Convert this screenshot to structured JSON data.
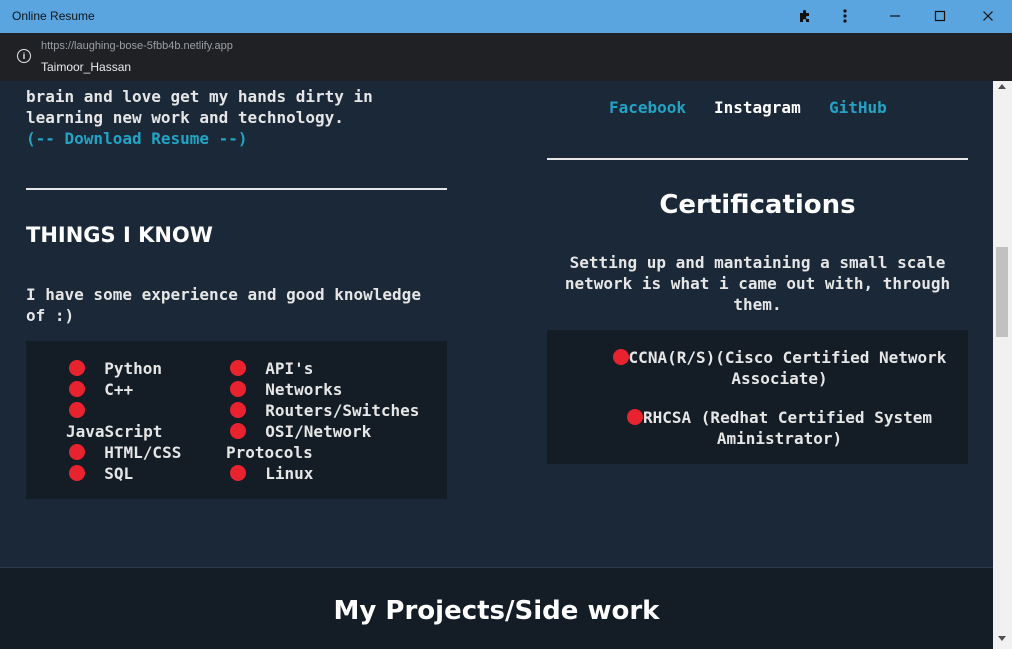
{
  "window": {
    "title": "Online Resume"
  },
  "browser": {
    "url": "https://laughing-bose-5fbb4b.netlify.app",
    "site_name": "Taimoor_Hassan"
  },
  "colors": {
    "accent": "#22a3c4",
    "bullet": "#e8232f",
    "background": "#1b2838",
    "box": "#141c25"
  },
  "about": {
    "line1": "brain and love get my hands dirty in",
    "line2": "learning new work and technology.",
    "download": "(-- Download Resume --)"
  },
  "social": {
    "facebook": "Facebook",
    "instagram": "Instagram",
    "github": "GitHub"
  },
  "skills": {
    "heading": "THINGS I KNOW",
    "intro": "I have some experience and good knowledge of :)",
    "col1": [
      "Python",
      "C++",
      "JavaScript",
      "HTML/CSS",
      "SQL"
    ],
    "col2": [
      "API's",
      "Networks",
      "Routers/Switches",
      "OSI/Network Protocols",
      "Linux"
    ]
  },
  "certifications": {
    "heading": "Certifications",
    "intro": "Setting up and mantaining a small scale network is what i came out with, through them.",
    "items": [
      "CCNA(R/S)(Cisco Certified Network Associate)",
      "RHCSA (Redhat Certified System Aministrator)"
    ]
  },
  "projects": {
    "heading": "My Projects/Side work"
  }
}
